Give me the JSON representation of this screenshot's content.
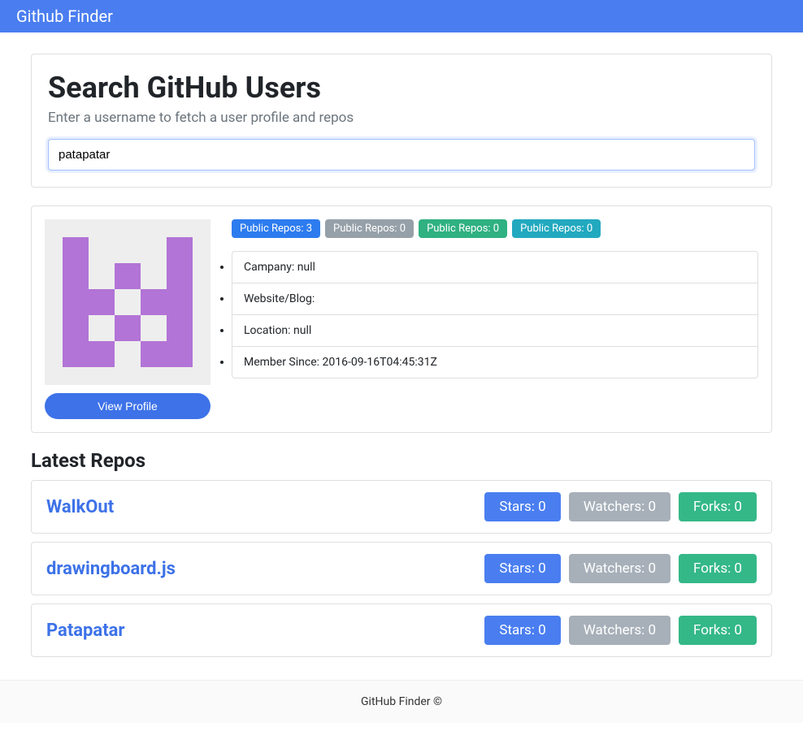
{
  "navbar": {
    "brand": "Github Finder"
  },
  "search": {
    "title": "Search GitHub Users",
    "lead": "Enter a username to fetch a user profile and repos",
    "value": "patapatar"
  },
  "profile": {
    "view_btn": "View Profile",
    "badges": [
      {
        "label": "Public Repos: 3",
        "cls": "badge-primary"
      },
      {
        "label": "Public Repos: 0",
        "cls": "badge-secondary"
      },
      {
        "label": "Public Repos: 0",
        "cls": "badge-success"
      },
      {
        "label": "Public Repos: 0",
        "cls": "badge-info"
      }
    ],
    "details": [
      "Campany: null",
      "Website/Blog:",
      "Location: null",
      "Member Since: 2016-09-16T04:45:31Z"
    ]
  },
  "repos_heading": "Latest Repos",
  "repos": [
    {
      "name": "WalkOut",
      "stars": "Stars: 0",
      "watchers": "Watchers: 0",
      "forks": "Forks: 0"
    },
    {
      "name": "drawingboard.js",
      "stars": "Stars: 0",
      "watchers": "Watchers: 0",
      "forks": "Forks: 0"
    },
    {
      "name": "Patapatar",
      "stars": "Stars: 0",
      "watchers": "Watchers: 0",
      "forks": "Forks: 0"
    }
  ],
  "footer": "GitHub Finder ©"
}
